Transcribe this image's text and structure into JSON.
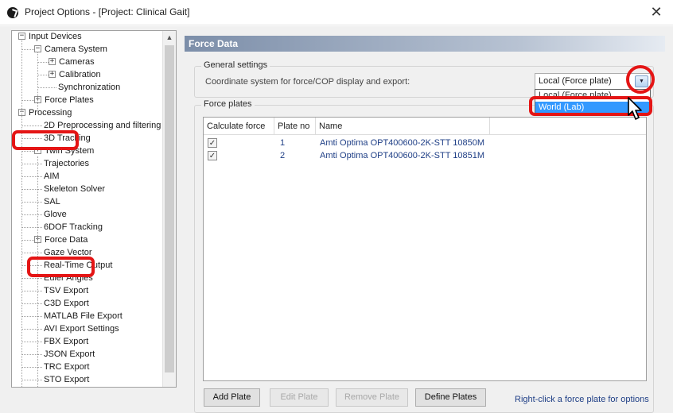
{
  "window": {
    "title": "Project Options - [Project: Clinical Gait]",
    "close_glyph": "✕"
  },
  "tree": {
    "items": [
      {
        "label": "Input Devices",
        "level": 0,
        "expander": "−"
      },
      {
        "label": "Camera System",
        "level": 1,
        "expander": "−"
      },
      {
        "label": "Cameras",
        "level": 2,
        "expander": "+"
      },
      {
        "label": "Calibration",
        "level": 2,
        "expander": "+"
      },
      {
        "label": "Synchronization",
        "level": 2,
        "expander": ""
      },
      {
        "label": "Force Plates",
        "level": 1,
        "expander": "+"
      },
      {
        "label": "Processing",
        "level": 0,
        "expander": "−"
      },
      {
        "label": "2D Preprocessing and filtering",
        "level": 1,
        "expander": ""
      },
      {
        "label": "3D Tracking",
        "level": 1,
        "expander": ""
      },
      {
        "label": "Twin System",
        "level": 1,
        "expander": "+"
      },
      {
        "label": "Trajectories",
        "level": 1,
        "expander": ""
      },
      {
        "label": "AIM",
        "level": 1,
        "expander": ""
      },
      {
        "label": "Skeleton Solver",
        "level": 1,
        "expander": ""
      },
      {
        "label": "SAL",
        "level": 1,
        "expander": ""
      },
      {
        "label": "Glove",
        "level": 1,
        "expander": ""
      },
      {
        "label": "6DOF Tracking",
        "level": 1,
        "expander": ""
      },
      {
        "label": "Force Data",
        "level": 1,
        "expander": "+"
      },
      {
        "label": "Gaze Vector",
        "level": 1,
        "expander": ""
      },
      {
        "label": "Real-Time Output",
        "level": 1,
        "expander": ""
      },
      {
        "label": "Euler Angles",
        "level": 1,
        "expander": ""
      },
      {
        "label": "TSV Export",
        "level": 1,
        "expander": ""
      },
      {
        "label": "C3D Export",
        "level": 1,
        "expander": ""
      },
      {
        "label": "MATLAB File Export",
        "level": 1,
        "expander": ""
      },
      {
        "label": "AVI Export Settings",
        "level": 1,
        "expander": ""
      },
      {
        "label": "FBX Export",
        "level": 1,
        "expander": ""
      },
      {
        "label": "JSON Export",
        "level": 1,
        "expander": ""
      },
      {
        "label": "TRC Export",
        "level": 1,
        "expander": ""
      },
      {
        "label": "STO Export",
        "level": 1,
        "expander": ""
      }
    ]
  },
  "panel": {
    "title": "Force Data",
    "general": {
      "legend": "General settings",
      "coord_label": "Coordinate system for force/COP display and export:",
      "coord_value": "Local (Force plate)",
      "options": [
        "Local (Force plate)",
        "World (Lab)"
      ],
      "highlighted_option": "World (Lab)"
    },
    "plates": {
      "legend": "Force plates",
      "columns": [
        "Calculate force",
        "Plate no",
        "Name"
      ],
      "rows": [
        {
          "checked": "✓",
          "plate_no": "1",
          "name": "Amti Optima OPT400600-2K-STT 10850M"
        },
        {
          "checked": "✓",
          "plate_no": "2",
          "name": "Amti Optima OPT400600-2K-STT 10851M"
        }
      ]
    },
    "buttons": {
      "add": "Add Plate",
      "edit": "Edit Plate",
      "remove": "Remove Plate",
      "define": "Define Plates"
    },
    "hint": "Right-click a force plate for options"
  },
  "colors": {
    "highlight": "#e41515",
    "selection": "#3399ff",
    "header_gradient_start": "#7c8ea9"
  }
}
